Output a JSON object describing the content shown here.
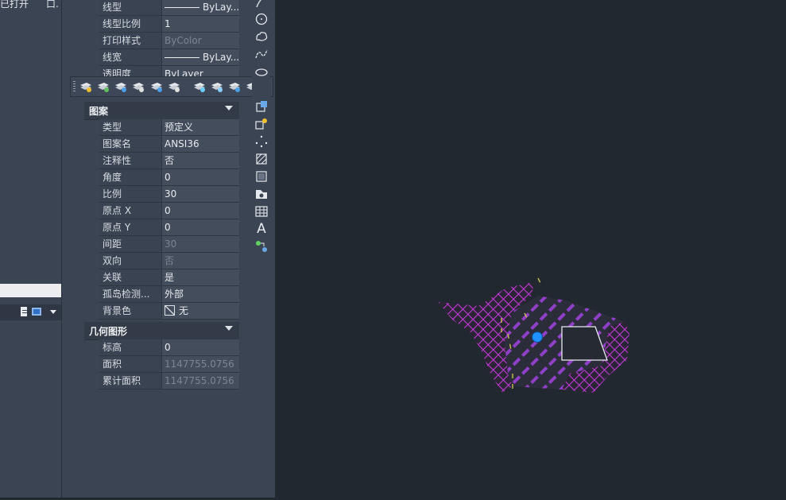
{
  "left_panel": {
    "title_left": "已打开",
    "title_right": "口."
  },
  "general_rows": [
    {
      "label": "线型",
      "value": "ByLay...",
      "line": true
    },
    {
      "label": "线型比例",
      "value": "1"
    },
    {
      "label": "打印样式",
      "value": "ByColor",
      "dim": true
    },
    {
      "label": "线宽",
      "value": "ByLay...",
      "line": true
    },
    {
      "label": "透明度",
      "value": "ByLayer"
    }
  ],
  "hatch_section": {
    "title": "图案",
    "rows": [
      {
        "label": "类型",
        "value": "预定义"
      },
      {
        "label": "图案名",
        "value": "ANSI36"
      },
      {
        "label": "注释性",
        "value": "否"
      },
      {
        "label": "角度",
        "value": "0"
      },
      {
        "label": "比例",
        "value": "30"
      },
      {
        "label": "原点 X",
        "value": "0"
      },
      {
        "label": "原点 Y",
        "value": "0"
      },
      {
        "label": "间距",
        "value": "30",
        "dim": true
      },
      {
        "label": "双向",
        "value": "否",
        "dim": true
      },
      {
        "label": "关联",
        "value": "是"
      },
      {
        "label": "孤岛检测...",
        "value": "外部"
      },
      {
        "label": "背景色",
        "value": "无",
        "swatch": true
      }
    ]
  },
  "geometry_section": {
    "title": "几何图形",
    "rows": [
      {
        "label": "标高",
        "value": "0"
      },
      {
        "label": "面积",
        "value": "1147755.0756",
        "dim": true
      },
      {
        "label": "累计面积",
        "value": "1147755.0756",
        "dim": true
      }
    ]
  },
  "layer_toolbar": {
    "close_glyph": "×",
    "icons": [
      "layer-icon",
      "layer-match-icon",
      "layer-previous-icon",
      "layer-isolate-icon",
      "layer-walk-icon",
      "layer-unisolate-icon",
      "layer-freeze-icon",
      "layer-off-icon",
      "layer-lock-icon",
      "layer-unlock-icon"
    ]
  },
  "draw_tools": {
    "text_glyph": "A",
    "icons": [
      "arc-icon",
      "circle-icon",
      "revision-cloud-icon",
      "spline-icon",
      "ellipse-icon",
      "insert-block-icon",
      "make-block-icon",
      "point-icon",
      "hatch-icon",
      "gradient-icon",
      "region-icon",
      "table-icon",
      "text-icon",
      "add-selected-icon"
    ]
  },
  "colors": {
    "hatch_fill": "#c03ad6",
    "hatch_lines": "#8f3fc8",
    "grip": "#1e90ff",
    "panel_bg": "#3b4453",
    "canvas_bg": "#212830"
  }
}
